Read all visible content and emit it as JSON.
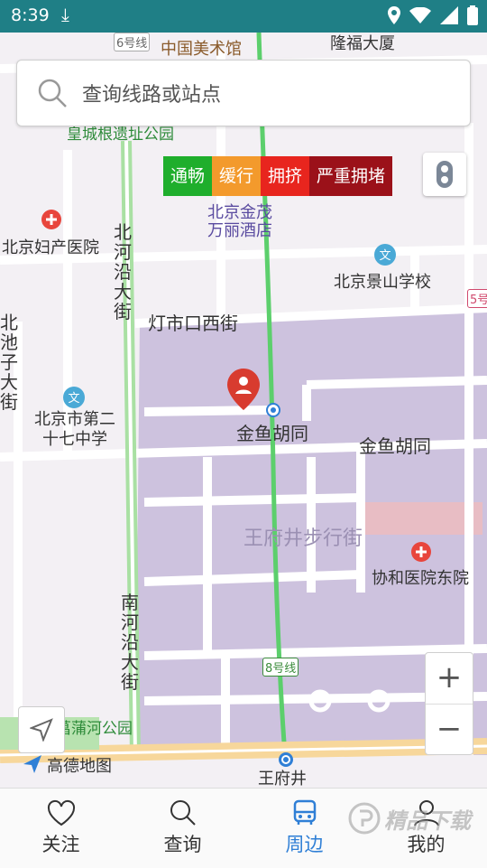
{
  "status": {
    "time": "8:39"
  },
  "search": {
    "placeholder": "查询线路或站点"
  },
  "legend": [
    {
      "label": "通畅",
      "color": "#1fae2c"
    },
    {
      "label": "缓行",
      "color": "#f39a2c"
    },
    {
      "label": "拥挤",
      "color": "#e8251e"
    },
    {
      "label": "严重拥堵",
      "color": "#9b1119"
    }
  ],
  "map_labels": {
    "line6": "6号线",
    "meishuguan": "中国美术馆",
    "longfu": "隆福大厦",
    "huangcheng": "皇城根遗址公园",
    "fuchan": "北京妇产医院",
    "jinmao": "北京金茂万丽酒店",
    "jingshan": "北京景山学校",
    "line5": "5号",
    "beiheyan": "北河沿大街",
    "dengshikou": "灯市口西街",
    "beichizi": "北池子大街",
    "middle27": "北京市第二十七中学",
    "jinyu1": "金鱼胡同",
    "jinyu2": "金鱼胡同",
    "wangfujing_walk": "王府井步行街",
    "xiehe": "协和医院东院",
    "nanheyan": "南河沿大街",
    "line8": "8号线",
    "puhe": "菖蒲河公园",
    "wangfujing": "王府井",
    "map_brand": "高德地图"
  },
  "zoom": {
    "in": "+",
    "out": "−"
  },
  "tabs": [
    {
      "label": "关注",
      "icon": "heart-icon"
    },
    {
      "label": "查询",
      "icon": "search-icon"
    },
    {
      "label": "周边",
      "icon": "bus-icon",
      "active": true
    },
    {
      "label": "我的",
      "icon": "person-icon"
    }
  ],
  "watermark": "精品下载"
}
